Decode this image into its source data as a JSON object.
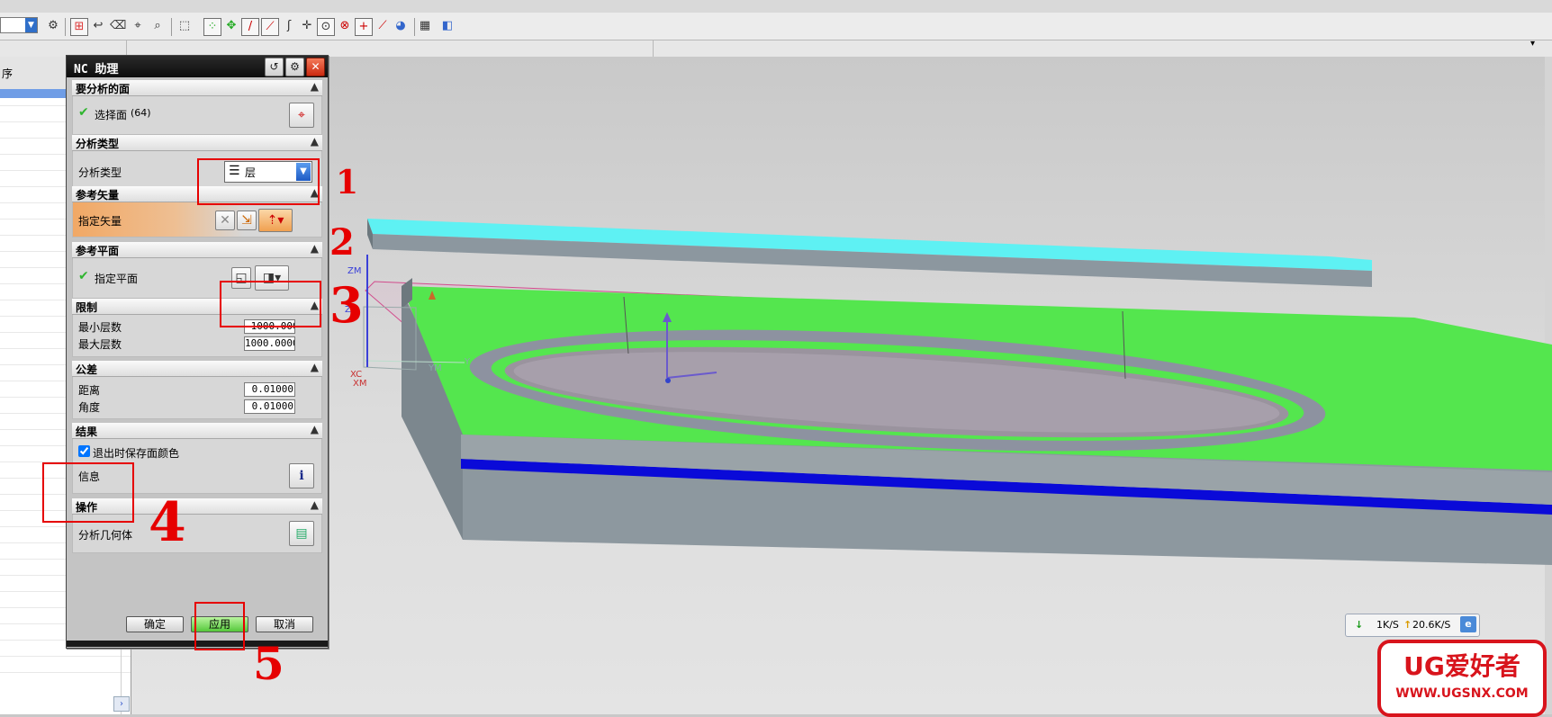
{
  "dialog": {
    "title": "NC 助理",
    "sections": {
      "faces": {
        "header": "要分析的面",
        "select_label": "选择面",
        "count": "(64)"
      },
      "analysis_type": {
        "header": "分析类型",
        "field_label": "分析类型",
        "value": "层"
      },
      "ref_vector": {
        "header": "参考矢量",
        "field_label": "指定矢量"
      },
      "ref_plane": {
        "header": "参考平面",
        "field_label": "指定平面"
      },
      "limits": {
        "header": "限制",
        "min_label": "最小层数",
        "min_value": "-1000.000",
        "max_label": "最大层数",
        "max_value": "1000.0000"
      },
      "tolerance": {
        "header": "公差",
        "distance_label": "距离",
        "distance_value": "0.01000",
        "angle_label": "角度",
        "angle_value": "0.01000"
      },
      "results": {
        "header": "结果",
        "save_color_label": "退出时保存面颜色",
        "save_color_checked": true,
        "info_label": "信息"
      },
      "operation": {
        "header": "操作",
        "analyze_label": "分析几何体"
      }
    },
    "buttons": {
      "ok": "确定",
      "apply": "应用",
      "cancel": "取消"
    }
  },
  "navigator": {
    "column_header": "序"
  },
  "axes": {
    "zm": "ZM",
    "zc": "ZC",
    "xc": "XC",
    "xm": "XM",
    "ym": "YM",
    "y": "Y",
    "triad_y": "Y",
    "triad_x": "X"
  },
  "annotations": [
    "1",
    "2",
    "3",
    "4",
    "5"
  ],
  "netspeed": {
    "down": "1K/S",
    "up": "20.6K/S"
  },
  "watermark": {
    "line1": "UG爱好者",
    "line2": "WWW.UGSNX.COM"
  },
  "colors": {
    "accent_red": "#e60000",
    "model_green": "#54e64e",
    "model_cyan": "#5ef1f3",
    "model_blue": "#0000e0",
    "model_gray": "#8c979f"
  }
}
